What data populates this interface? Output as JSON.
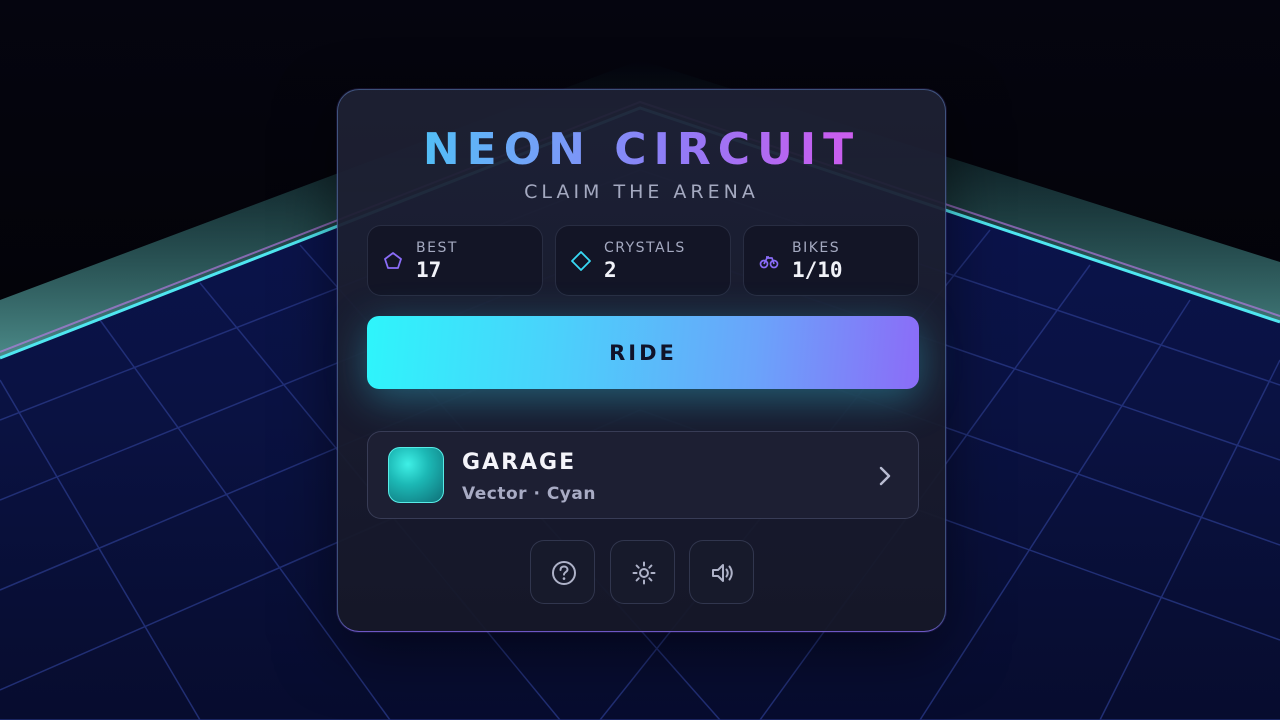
{
  "menu": {
    "title": "NEON CIRCUIT",
    "subtitle": "CLAIM THE ARENA"
  },
  "stats": [
    {
      "label": "BEST",
      "value": "17",
      "icon": "pentagon-icon"
    },
    {
      "label": "CRYSTALS",
      "value": "2",
      "icon": "diamond-icon"
    },
    {
      "label": "BIKES",
      "value": "1/10",
      "icon": "bike-icon"
    }
  ],
  "ride": {
    "label": "RIDE"
  },
  "garage": {
    "title": "GARAGE",
    "subtitle": "Vector · Cyan",
    "icon": "chevron-right-icon"
  },
  "controls": [
    {
      "name": "help",
      "icon": "help-icon"
    },
    {
      "name": "settings",
      "icon": "gear-icon"
    },
    {
      "name": "sound",
      "icon": "speaker-icon"
    }
  ],
  "colors": {
    "accent_cyan": "#2ef5fb",
    "accent_violet": "#8b6cf8",
    "title_start": "#38d3f5",
    "title_end": "#e35ce8",
    "grid_floor": "#0a1240",
    "grid_line": "#2a3a8a",
    "horizon_glow": "#4fe6f0"
  }
}
